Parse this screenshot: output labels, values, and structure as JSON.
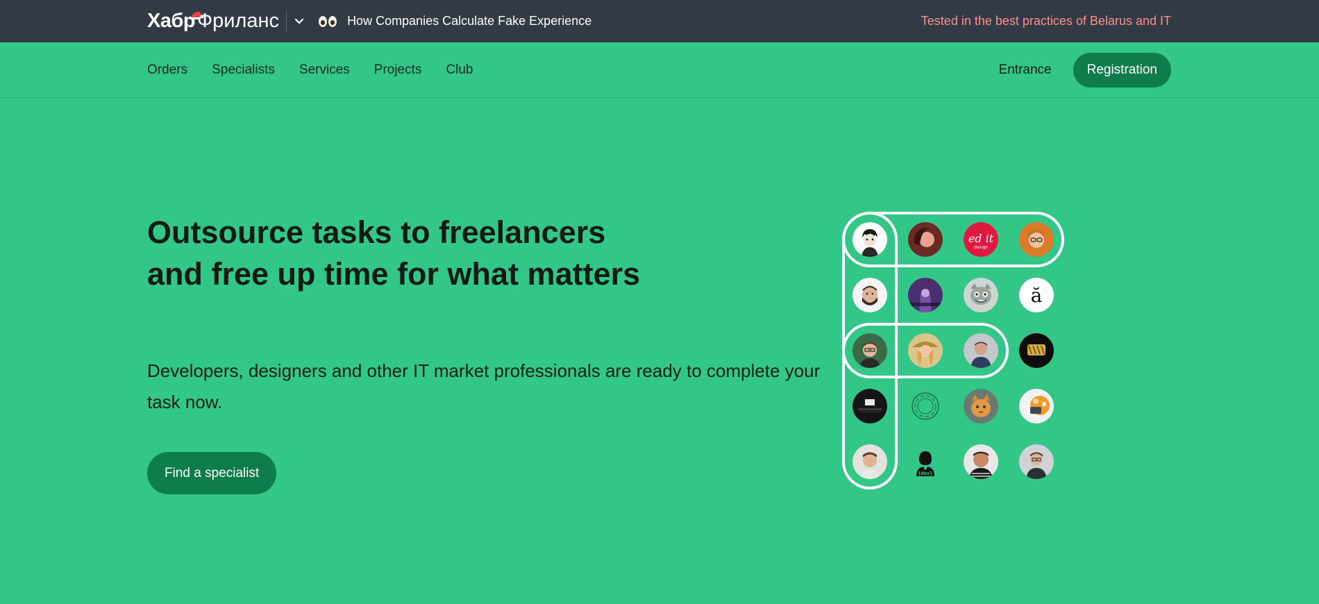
{
  "topbar": {
    "logo_primary": "Хабр",
    "logo_secondary": "Фриланс",
    "news_title": "How Companies Calculate Fake Experience",
    "promo_text": "Tested in the best practices of Belarus and IT"
  },
  "nav": {
    "items": [
      {
        "label": "Orders"
      },
      {
        "label": "Specialists"
      },
      {
        "label": "Services"
      },
      {
        "label": "Projects"
      },
      {
        "label": "Club"
      }
    ],
    "entrance_label": "Entrance",
    "registration_label": "Registration"
  },
  "hero": {
    "title": "Outsource tasks to freelancers and free up time for what matters",
    "subtitle": "Developers, designers and other IT market professionals are ready to complete your task now.",
    "cta_label": "Find a specialist"
  },
  "avatar_badges": {
    "edit_design_main": "ed it",
    "edit_design_small": "design",
    "letter_a": "ă",
    "dev_tag": "{dev}"
  },
  "colors": {
    "topbar_bg": "#313a45",
    "page_bg": "#33c787",
    "button_bg": "#0f7c4c",
    "promo_text": "#ff8f8f"
  }
}
